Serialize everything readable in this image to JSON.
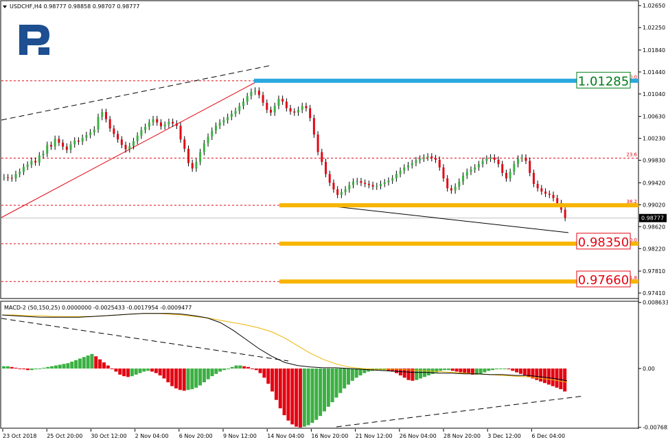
{
  "chart_data": {
    "type": "candlestick",
    "title": "USDCHF,H4",
    "ohlc_header": "0.98777 0.98858 0.98707 0.98777",
    "current_price": "0.98777",
    "price_axis": {
      "range": [
        0.9731,
        1.0274
      ],
      "ticks": [
        "1.02650",
        "1.02250",
        "1.01840",
        "1.01440",
        "1.01040",
        "1.00630",
        "1.00230",
        "0.99830",
        "0.99420",
        "0.99020",
        "0.98620",
        "0.98220",
        "0.97810",
        "0.97410"
      ]
    },
    "time_axis": {
      "ticks": [
        "23 Oct 2018",
        "25 Oct 20:00",
        "30 Oct 12:00",
        "2 Nov 04:00",
        "6 Nov 20:00",
        "9 Nov 12:00",
        "14 Nov 04:00",
        "16 Nov 20:00",
        "21 Nov 12:00",
        "26 Nov 04:00",
        "28 Nov 20:00",
        "3 Dec 12:00",
        "6 Dec 04:00"
      ]
    },
    "series": [
      {
        "name": "USDCHF H4 close (approximate)",
        "values": [
          0.9952,
          0.9951,
          0.995,
          0.9958,
          0.9962,
          0.9971,
          0.9975,
          0.9982,
          0.9979,
          0.9992,
          0.9995,
          1.0011,
          1.0008,
          1.0022,
          1.0015,
          1.0008,
          1.0002,
          1.0012,
          1.0019,
          1.0017,
          1.0024,
          1.0029,
          1.0034,
          1.0039,
          1.0062,
          1.0071,
          1.0058,
          1.0041,
          1.0031,
          1.0021,
          1.0011,
          1.0003,
          1.0009,
          1.0018,
          1.0028,
          1.0038,
          1.0044,
          1.0052,
          1.0058,
          1.0052,
          1.0045,
          1.0048,
          1.0053,
          1.005,
          1.0046,
          1.0021,
          1.0004,
          0.9978,
          0.9968,
          0.998,
          0.9998,
          1.0014,
          1.0026,
          1.0037,
          1.0046,
          1.0052,
          1.0056,
          1.0062,
          1.0068,
          1.0073,
          1.0082,
          1.009,
          1.01,
          1.0108,
          1.011,
          1.0102,
          1.0088,
          1.0075,
          1.007,
          1.0082,
          1.0095,
          1.009,
          1.0078,
          1.0072,
          1.007,
          1.0075,
          1.0082,
          1.0078,
          1.006,
          1.003,
          0.9998,
          0.998,
          0.9958,
          0.9942,
          0.993,
          0.992,
          0.9925,
          0.993,
          0.9938,
          0.9944,
          0.9945,
          0.9942,
          0.994,
          0.9938,
          0.9935,
          0.9936,
          0.994,
          0.9943,
          0.9946,
          0.995,
          0.9958,
          0.9964,
          0.997,
          0.9974,
          0.9978,
          0.9983,
          0.9986,
          0.9988,
          0.999,
          0.9987,
          0.9984,
          0.997,
          0.995,
          0.9932,
          0.9928,
          0.9935,
          0.9944,
          0.9955,
          0.9962,
          0.9966,
          0.997,
          0.9976,
          0.9982,
          0.9986,
          0.9988,
          0.9984,
          0.9976,
          0.996,
          0.995,
          0.9962,
          0.9976,
          0.9986,
          0.9988,
          0.9982,
          0.996,
          0.994,
          0.9932,
          0.9926,
          0.9922,
          0.992,
          0.9914,
          0.9905,
          0.9893,
          0.9878
        ]
      }
    ],
    "fibonacci": {
      "levels": [
        {
          "label": "0.0",
          "price": 1.0128
        },
        {
          "label": "23.6",
          "price": 0.9987
        },
        {
          "label": "38.2",
          "price": 0.9901
        },
        {
          "label": "50.0",
          "price": 0.9831
        },
        {
          "label": "61.8",
          "price": 0.9762
        }
      ]
    },
    "price_labels": [
      {
        "text": "1.01285",
        "price": 1.01285,
        "color": "#007a1a"
      },
      {
        "text": "0.98350",
        "price": 0.9835,
        "color": "#e30613"
      },
      {
        "text": "0.97660",
        "price": 0.9766,
        "color": "#e30613"
      }
    ],
    "macd": {
      "title": "MACD-2 (50,150,25) 0.0000000 -0.0025433 -0.0017954 -0.0009477",
      "range": [
        -0.0078,
        0.0087
      ],
      "ticks": [
        "0.008633",
        "0.00",
        "-0.007682"
      ],
      "histogram": [
        0.0003,
        0.0003,
        0.0002,
        0.0001,
        0.0,
        -0.0001,
        -0.0002,
        -0.0002,
        -0.0001,
        0.0,
        0.0001,
        0.0002,
        0.0003,
        0.0004,
        0.0005,
        0.0006,
        0.0007,
        0.0009,
        0.0011,
        0.0013,
        0.0015,
        0.0017,
        0.0019,
        0.0016,
        0.0012,
        0.0008,
        0.0004,
        0.0,
        -0.0004,
        -0.0008,
        -0.001,
        -0.0011,
        -0.001,
        -0.0008,
        -0.0006,
        -0.0004,
        -0.0003,
        -0.0004,
        -0.0006,
        -0.0009,
        -0.0013,
        -0.0018,
        -0.0023,
        -0.0026,
        -0.0028,
        -0.0029,
        -0.0028,
        -0.0027,
        -0.0025,
        -0.0022,
        -0.0018,
        -0.0014,
        -0.001,
        -0.0007,
        -0.0004,
        -0.0002,
        0.0,
        0.0002,
        0.0004,
        0.0004,
        0.0003,
        0.0002,
        0.0,
        -0.0002,
        -0.0006,
        -0.0012,
        -0.002,
        -0.003,
        -0.0041,
        -0.0052,
        -0.0061,
        -0.0068,
        -0.0073,
        -0.0076,
        -0.0077,
        -0.0076,
        -0.0074,
        -0.0071,
        -0.0067,
        -0.0062,
        -0.0056,
        -0.005,
        -0.0044,
        -0.0038,
        -0.0032,
        -0.0026,
        -0.0021,
        -0.0016,
        -0.0012,
        -0.0009,
        -0.0006,
        -0.0004,
        -0.0003,
        -0.0002,
        -0.0002,
        -0.0002,
        -0.0003,
        -0.0004,
        -0.0006,
        -0.0009,
        -0.0012,
        -0.0015,
        -0.0016,
        -0.0015,
        -0.0013,
        -0.0011,
        -0.0009,
        -0.0007,
        -0.0005,
        -0.0003,
        -0.0002,
        -0.0002,
        -0.0003,
        -0.0004,
        -0.0005,
        -0.0006,
        -0.0007,
        -0.0008,
        -0.0008,
        -0.0007,
        -0.0005,
        -0.0003,
        -0.0002,
        -0.0001,
        0.0,
        0.0,
        -0.0001,
        -0.0003,
        -0.0005,
        -0.0007,
        -0.0009,
        -0.0011,
        -0.0013,
        -0.0015,
        -0.0017,
        -0.0019,
        -0.0021,
        -0.0023,
        -0.0025,
        -0.0027,
        -0.003
      ],
      "signal_line": [
        0.007,
        0.007,
        0.0069,
        0.0069,
        0.0068,
        0.0068,
        0.0068,
        0.0068,
        0.0069,
        0.007,
        0.0071,
        0.0072,
        0.0072,
        0.0071,
        0.007,
        0.0068,
        0.0066,
        0.0063,
        0.006,
        0.0057,
        0.0053,
        0.0048,
        0.004,
        0.003,
        0.002,
        0.0012,
        0.0006,
        0.0002,
        0.0,
        -0.0001,
        -0.0001,
        -0.0001,
        -0.0002,
        -0.0003,
        -0.0004,
        -0.0005,
        -0.0006,
        -0.0007,
        -0.0008,
        -0.0009,
        -0.001,
        -0.0011,
        -0.0013,
        -0.0015,
        -0.0018
      ],
      "main_line": [
        0.007,
        0.0069,
        0.0068,
        0.0067,
        0.0067,
        0.0067,
        0.0067,
        0.0068,
        0.0069,
        0.007,
        0.0071,
        0.0072,
        0.0072,
        0.0072,
        0.0071,
        0.0069,
        0.0066,
        0.006,
        0.005,
        0.0038,
        0.0026,
        0.0016,
        0.0008,
        0.0004,
        0.0002,
        0.0001,
        0.0001,
        0.0,
        -0.0001,
        -0.0002,
        -0.0003,
        -0.0004,
        -0.0005,
        -0.0005,
        -0.0006,
        -0.0006,
        -0.0007,
        -0.0007,
        -0.0008,
        -0.0008,
        -0.0009,
        -0.0009,
        -0.0011,
        -0.0013,
        -0.0016
      ]
    }
  }
}
